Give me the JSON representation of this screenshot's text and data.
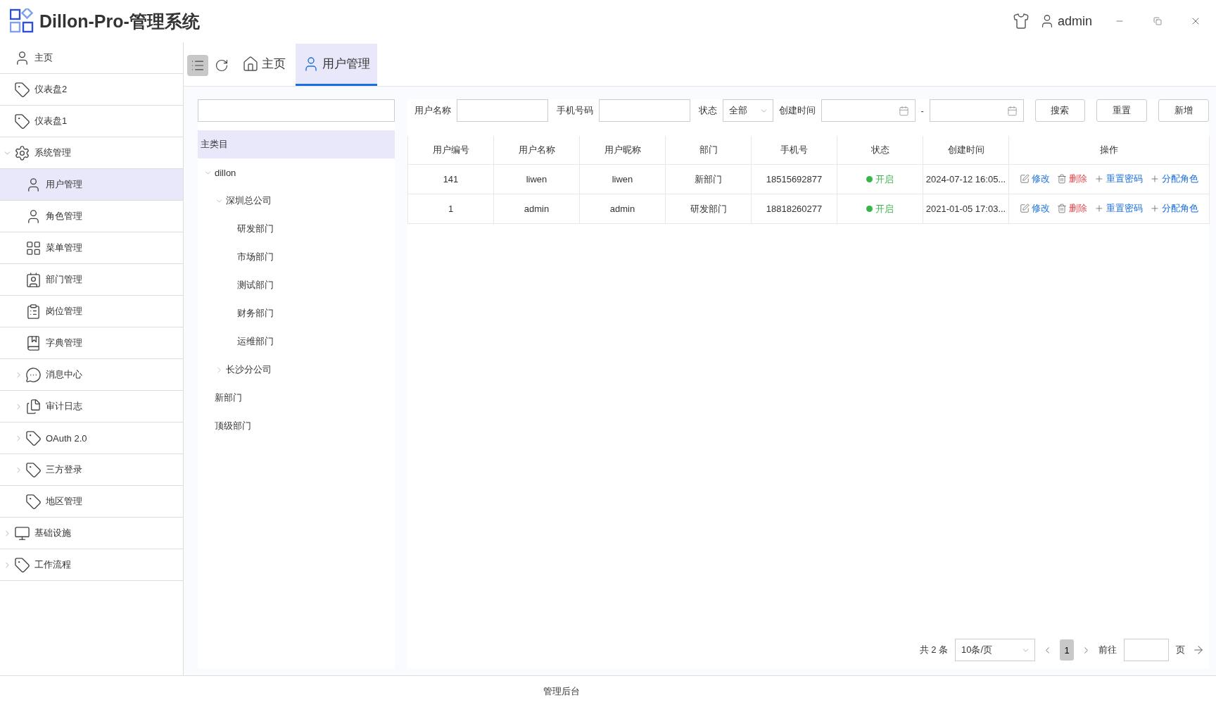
{
  "header": {
    "title": "Dillon-Pro-管理系统",
    "user": "admin"
  },
  "sidebar": {
    "items": [
      {
        "label": "主页",
        "selected": false
      },
      {
        "label": "仪表盘2",
        "selected": false
      },
      {
        "label": "仪表盘1",
        "selected": false
      },
      {
        "label": "系统管理",
        "selected": false,
        "expanded": true,
        "children": [
          {
            "label": "用户管理",
            "selected": true
          },
          {
            "label": "角色管理",
            "selected": false
          },
          {
            "label": "菜单管理",
            "selected": false
          },
          {
            "label": "部门管理",
            "selected": false
          },
          {
            "label": "岗位管理",
            "selected": false
          },
          {
            "label": "字典管理",
            "selected": false
          },
          {
            "label": "消息中心",
            "selected": false,
            "expanded": false
          },
          {
            "label": "审计日志",
            "selected": false,
            "expanded": false
          },
          {
            "label": "OAuth 2.0",
            "selected": false,
            "expanded": false
          },
          {
            "label": "三方登录",
            "selected": false,
            "expanded": false
          },
          {
            "label": "地区管理",
            "selected": false
          }
        ]
      },
      {
        "label": "基础设施",
        "selected": false,
        "expanded": false
      },
      {
        "label": "工作流程",
        "selected": false,
        "expanded": false
      }
    ]
  },
  "tabs": [
    {
      "label": "主页",
      "selected": false
    },
    {
      "label": "用户管理",
      "selected": true
    }
  ],
  "tree": {
    "root": {
      "label": "主类目",
      "selected": true,
      "children": [
        {
          "label": "dillon",
          "selected": false,
          "expanded": true,
          "children": [
            {
              "label": "深圳总公司",
              "selected": false,
              "expanded": true,
              "children": [
                {
                  "label": "研发部门",
                  "selected": false
                },
                {
                  "label": "市场部门",
                  "selected": false
                },
                {
                  "label": "测试部门",
                  "selected": false
                },
                {
                  "label": "财务部门",
                  "selected": false
                },
                {
                  "label": "运维部门",
                  "selected": false
                }
              ]
            },
            {
              "label": "长沙分公司",
              "selected": false,
              "expanded": false
            }
          ]
        },
        {
          "label": "新部门",
          "selected": false
        },
        {
          "label": "顶级部门",
          "selected": false
        }
      ]
    }
  },
  "filters": {
    "username_label": "用户名称",
    "phone_label": "手机号码",
    "status_label": "状态",
    "status_value": "全部",
    "created_label": "创建时间",
    "range_separator": "-",
    "buttons": [
      "搜索",
      "重置",
      "新增"
    ]
  },
  "table": {
    "columns": [
      "用户编号",
      "用户名称",
      "用户昵称",
      "部门",
      "手机号",
      "状态",
      "创建时间",
      "操作"
    ],
    "rows": [
      {
        "id": "141",
        "username": "liwen",
        "nickname": "liwen",
        "dept": "新部门",
        "phone": "18515692877",
        "status": "开启",
        "enabled": true,
        "created": "2024-07-12 16:05...",
        "actions": [
          {
            "kind": "edit",
            "label": "修改"
          },
          {
            "kind": "delete",
            "label": "删除"
          },
          {
            "kind": "add",
            "label": "重置密码"
          },
          {
            "kind": "add",
            "label": "分配角色"
          }
        ]
      },
      {
        "id": "1",
        "username": "admin",
        "nickname": "admin",
        "dept": "研发部门",
        "phone": "18818260277",
        "status": "开启",
        "enabled": true,
        "created": "2021-01-05 17:03...",
        "actions": [
          {
            "kind": "edit",
            "label": "修改"
          },
          {
            "kind": "delete",
            "label": "删除"
          },
          {
            "kind": "add",
            "label": "重置密码"
          },
          {
            "kind": "add",
            "label": "分配角色"
          }
        ]
      }
    ]
  },
  "pagination": {
    "total": "共 2 条",
    "page_size": "10条/页",
    "pages": [
      {
        "label": "1",
        "selected": true
      }
    ],
    "goto_label": "前往",
    "page_suffix": "页"
  },
  "footer": {
    "text": "管理后台"
  }
}
